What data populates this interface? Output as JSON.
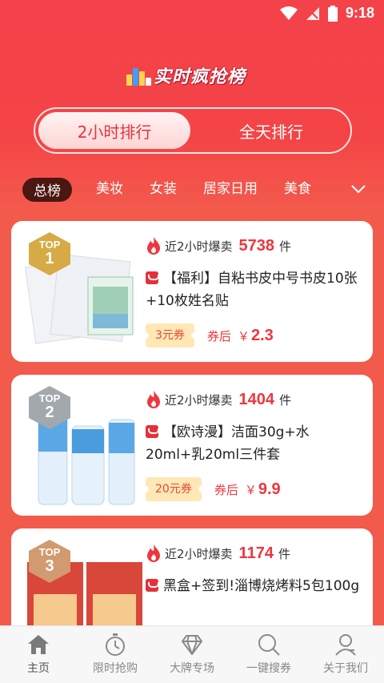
{
  "status_bar": {
    "time": "9:18"
  },
  "header": {
    "title": "实时疯抢榜"
  },
  "switch": {
    "active": "2小时排行",
    "inactive": "全天排行"
  },
  "categories": {
    "items": [
      "总榜",
      "美妆",
      "女装",
      "居家日用",
      "美食"
    ],
    "selected": "总榜"
  },
  "products": [
    {
      "rank_label": "TOP",
      "rank": "1",
      "sales_label": "近2小时爆卖",
      "sales": "5738",
      "unit": "件",
      "title": "【福利】自粘书皮中号书皮10张+10枚姓名贴",
      "coupon": "3元券",
      "after_label": "券后",
      "currency": "￥",
      "price": "2.3"
    },
    {
      "rank_label": "TOP",
      "rank": "2",
      "sales_label": "近2小时爆卖",
      "sales": "1404",
      "unit": "件",
      "title": "【欧诗漫】洁面30g+水20ml+乳20ml三件套",
      "coupon": "20元券",
      "after_label": "券后",
      "currency": "￥",
      "price": "9.9"
    },
    {
      "rank_label": "TOP",
      "rank": "3",
      "sales_label": "近2小时爆卖",
      "sales": "1174",
      "unit": "件",
      "title": "黑盒+签到!淄博烧烤料5包100g"
    }
  ],
  "tabbar": {
    "items": [
      {
        "label": "主页",
        "icon": "home-icon"
      },
      {
        "label": "限时抢购",
        "icon": "stopwatch-icon"
      },
      {
        "label": "大牌专场",
        "icon": "diamond-icon"
      },
      {
        "label": "一键搜券",
        "icon": "search-icon"
      },
      {
        "label": "关于我们",
        "icon": "user-icon"
      }
    ]
  },
  "colors": {
    "brand_red": "#f4424a",
    "price_red": "#f0363d",
    "coupon_bg": "#ffe7b6",
    "category_active_bg": "#4a1711"
  }
}
